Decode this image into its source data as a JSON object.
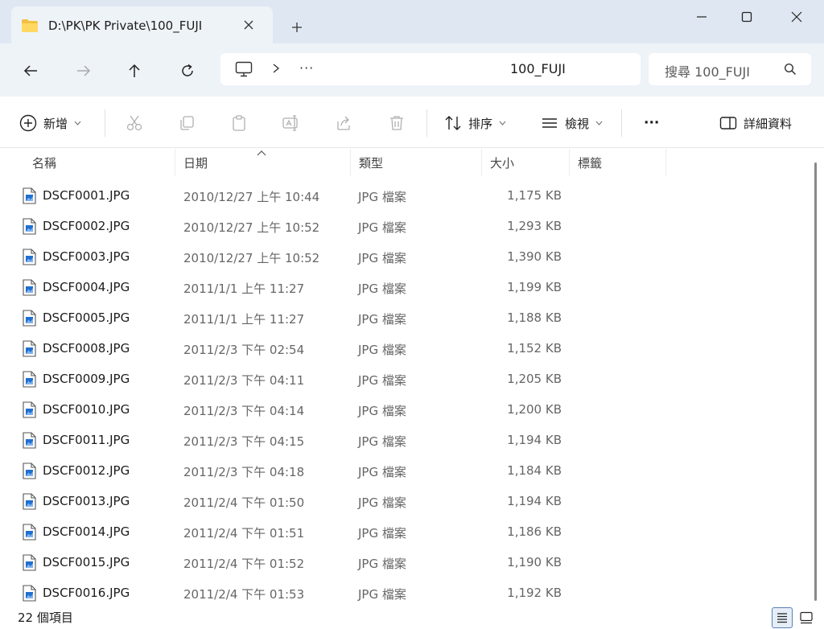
{
  "tab": {
    "title": "D:\\PK\\PK Private\\100_FUJI"
  },
  "address": {
    "path": "100_FUJI",
    "overflow": "···"
  },
  "search": {
    "placeholder": "搜尋 100_FUJI"
  },
  "toolbar": {
    "new_label": "新增",
    "sort_label": "排序",
    "view_label": "檢視",
    "more_label": "···",
    "details_label": "詳細資料"
  },
  "columns": {
    "name": "名稱",
    "date": "日期",
    "type": "類型",
    "size": "大小",
    "tags": "標籤"
  },
  "files": [
    {
      "name": "DSCF0001.JPG",
      "date": "2010/12/27 上午 10:44",
      "type": "JPG 檔案",
      "size": "1,175 KB"
    },
    {
      "name": "DSCF0002.JPG",
      "date": "2010/12/27 上午 10:52",
      "type": "JPG 檔案",
      "size": "1,293 KB"
    },
    {
      "name": "DSCF0003.JPG",
      "date": "2010/12/27 上午 10:52",
      "type": "JPG 檔案",
      "size": "1,390 KB"
    },
    {
      "name": "DSCF0004.JPG",
      "date": "2011/1/1 上午 11:27",
      "type": "JPG 檔案",
      "size": "1,199 KB"
    },
    {
      "name": "DSCF0005.JPG",
      "date": "2011/1/1 上午 11:27",
      "type": "JPG 檔案",
      "size": "1,188 KB"
    },
    {
      "name": "DSCF0008.JPG",
      "date": "2011/2/3 下午 02:54",
      "type": "JPG 檔案",
      "size": "1,152 KB"
    },
    {
      "name": "DSCF0009.JPG",
      "date": "2011/2/3 下午 04:11",
      "type": "JPG 檔案",
      "size": "1,205 KB"
    },
    {
      "name": "DSCF0010.JPG",
      "date": "2011/2/3 下午 04:14",
      "type": "JPG 檔案",
      "size": "1,200 KB"
    },
    {
      "name": "DSCF0011.JPG",
      "date": "2011/2/3 下午 04:15",
      "type": "JPG 檔案",
      "size": "1,194 KB"
    },
    {
      "name": "DSCF0012.JPG",
      "date": "2011/2/3 下午 04:18",
      "type": "JPG 檔案",
      "size": "1,184 KB"
    },
    {
      "name": "DSCF0013.JPG",
      "date": "2011/2/4 下午 01:50",
      "type": "JPG 檔案",
      "size": "1,194 KB"
    },
    {
      "name": "DSCF0014.JPG",
      "date": "2011/2/4 下午 01:51",
      "type": "JPG 檔案",
      "size": "1,186 KB"
    },
    {
      "name": "DSCF0015.JPG",
      "date": "2011/2/4 下午 01:52",
      "type": "JPG 檔案",
      "size": "1,190 KB"
    },
    {
      "name": "DSCF0016.JPG",
      "date": "2011/2/4 下午 01:53",
      "type": "JPG 檔案",
      "size": "1,192 KB"
    }
  ],
  "status": {
    "count": "22 個項目"
  },
  "colors": {
    "accent": "#0f6cbd",
    "titlebar": "#dfe8f2",
    "navbar": "#eef3f8",
    "folder": "#f4c042"
  }
}
